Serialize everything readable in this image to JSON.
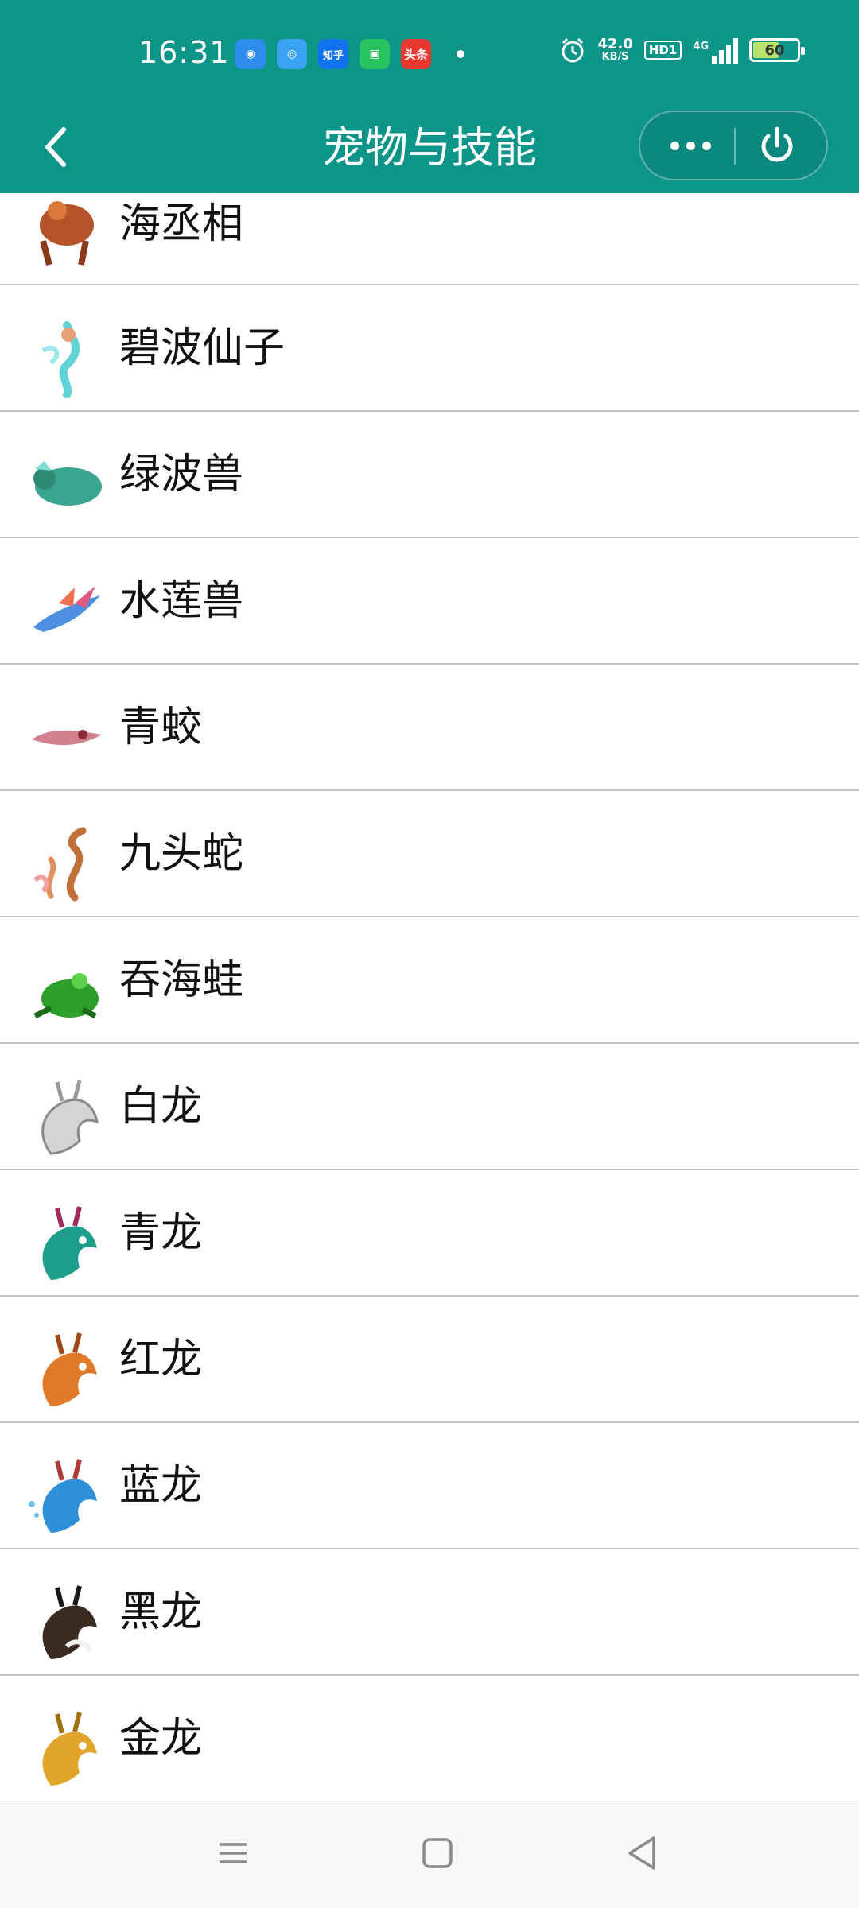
{
  "status_bar": {
    "time": "16:31",
    "apps": [
      "DingTalk",
      "Browser",
      "知乎",
      "WeChat",
      "头条"
    ],
    "network_speed_value": "42.0",
    "network_speed_unit": "KB/S",
    "hd_label": "HD1",
    "signal_label": "4G",
    "battery_level": "60"
  },
  "header": {
    "title": "宠物与技能",
    "back_icon": "chevron-left-icon",
    "more_icon": "more-dots-icon",
    "power_icon": "power-icon",
    "bg_color": "#0e958a"
  },
  "pets": [
    {
      "name": "海丞相",
      "color": "#b5542a"
    },
    {
      "name": "碧波仙子",
      "color": "#5fd3d6"
    },
    {
      "name": "绿波兽",
      "color": "#3aa58f"
    },
    {
      "name": "水莲兽",
      "color": "#4c8fe0"
    },
    {
      "name": "青蛟",
      "color": "#c96a7a"
    },
    {
      "name": "九头蛇",
      "color": "#c2703a"
    },
    {
      "name": "吞海蛙",
      "color": "#2e9e2a"
    },
    {
      "name": "白龙",
      "color": "#bcbcbc"
    },
    {
      "name": "青龙",
      "color": "#1e9e8a"
    },
    {
      "name": "红龙",
      "color": "#e07a2a"
    },
    {
      "name": "蓝龙",
      "color": "#2f8fd8"
    },
    {
      "name": "黑龙",
      "color": "#3a2a22"
    },
    {
      "name": "金龙",
      "color": "#e0a52a"
    }
  ],
  "nav_bar": {
    "menu_icon": "menu-icon",
    "home_icon": "home-square-icon",
    "back_icon": "back-triangle-icon"
  }
}
